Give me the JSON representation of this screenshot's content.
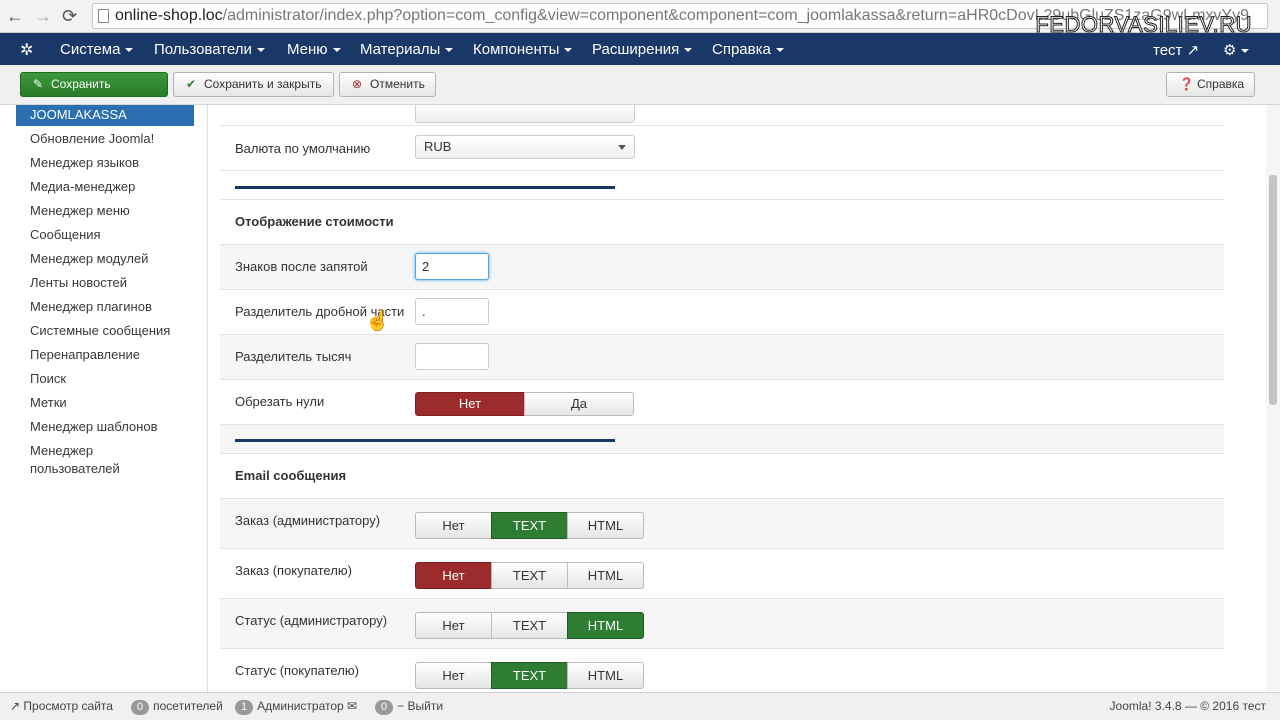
{
  "browser": {
    "url_host": "online-shop.loc",
    "url_path": "/administrator/index.php?option=com_config&view=component&component=com_joomlakassa&return=aHR0cDovL29ubGluZS1zaG9wLmxvYy9",
    "watermark": "FEDORVASILIEV.RU"
  },
  "topnav": {
    "items": [
      "Система",
      "Пользователи",
      "Меню",
      "Материалы",
      "Компоненты",
      "Расширения",
      "Справка"
    ],
    "user": "тест"
  },
  "toolbar": {
    "save": "Сохранить",
    "save_close": "Сохранить и закрыть",
    "cancel": "Отменить",
    "help": "Справка"
  },
  "sidebar": {
    "active": "JOOMLAKASSA",
    "items": [
      "Обновление Joomla!",
      "Менеджер языков",
      "Медиа-менеджер",
      "Менеджер меню",
      "Сообщения",
      "Менеджер модулей",
      "Ленты новостей",
      "Менеджер плагинов",
      "Системные сообщения",
      "Перенаправление",
      "Поиск",
      "Метки",
      "Менеджер шаблонов",
      "Менеджер пользователей"
    ]
  },
  "form": {
    "currency_label": "Валюта по умолчанию",
    "currency_value": "RUB",
    "price_section": "Отображение стоимости",
    "decimals_label": "Знаков после запятой",
    "decimals_value": "2",
    "decimal_sep_label": "Разделитель дробной части",
    "decimal_sep_value": ".",
    "thousand_sep_label": "Разделитель тысяч",
    "thousand_sep_value": "",
    "trim_zeros_label": "Обрезать нули",
    "no": "Нет",
    "yes": "Да",
    "email_section": "Email сообщения",
    "order_admin_label": "Заказ (администратору)",
    "order_buyer_label": "Заказ (покупателю)",
    "status_admin_label": "Статус (администратору)",
    "status_buyer_label": "Статус (покупателю)",
    "opt_text": "TEXT",
    "opt_html": "HTML"
  },
  "status": {
    "view_site": "Просмотр сайта",
    "visitors_count": "0",
    "visitors": "посетителей",
    "admins_count": "1",
    "admins": "Администратор",
    "messages_count": "0",
    "logout": "Выйти",
    "footer": "Joomla! 3.4.8 — © 2016 тест"
  },
  "colors": {
    "navbar": "#1a3867",
    "active_red": "#9c2b2b",
    "active_green": "#2e7d32"
  }
}
